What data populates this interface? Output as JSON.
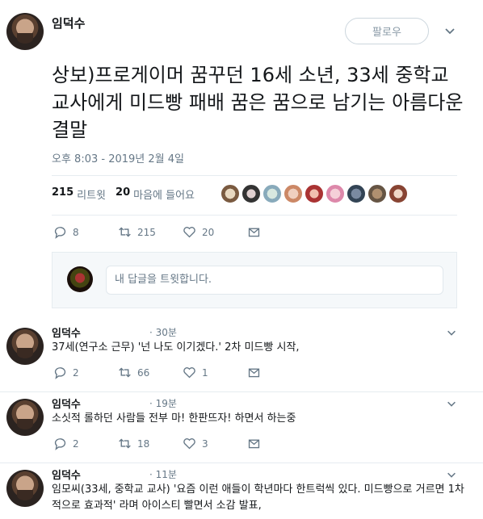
{
  "author": {
    "name": "임덕수"
  },
  "follow_label": "팔로우",
  "tweet": {
    "text": "상보)프로게이머 꿈꾸던 16세 소년, 33세 중학교 교사에게 미드빵 패배 꿈은 꿈으로 남기는 아름다운 결말",
    "timestamp": "오후 8:03 - 2019년 2월 4일",
    "retweets": "215",
    "retweets_label": "리트윗",
    "likes": "20",
    "likes_label": "마음에 들어요",
    "reply_count": "8",
    "retweet_count": "215",
    "like_count": "20"
  },
  "reply_placeholder": "내 답글을 트윗합니다.",
  "replies": [
    {
      "name": "임덕수",
      "time": "· 30분",
      "text": "37세(연구소 근무) '넌 나도 이기겠다.' 2차 미드빵 시작,",
      "reply_count": "2",
      "retweet_count": "66",
      "like_count": "1"
    },
    {
      "name": "임덕수",
      "time": "· 19분",
      "text": "소싯적 롤하던 사람들 전부 마! 한판뜨자! 하면서 하는중",
      "reply_count": "2",
      "retweet_count": "18",
      "like_count": "3"
    },
    {
      "name": "임덕수",
      "time": "· 11분",
      "text": "임모씨(33세, 중학교 교사) '요즘 이런 애들이 학년마다 한트럭씩 있다. 미드빵으로 거르면 1차적으로 효과적' 라며 아이스티 빨면서 소감 발표,"
    }
  ],
  "colors": {
    "text": "#14171a",
    "muted": "#657786",
    "border": "#e6ecf0",
    "accent": "#1da1f2"
  }
}
